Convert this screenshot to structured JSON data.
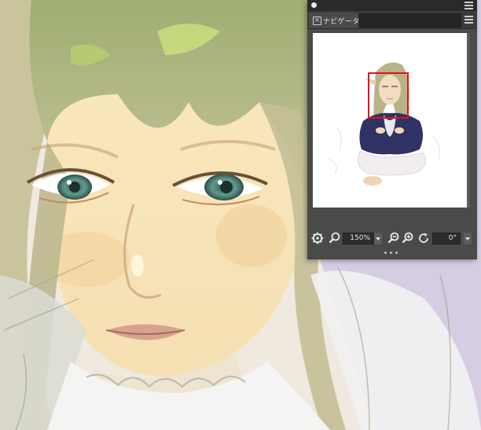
{
  "navigator": {
    "tab_label": "ナビゲータ",
    "zoom_value": "150%",
    "rotation_value": "0°",
    "viewport_rect_color": "#e0141e"
  },
  "icons": {
    "panel_menu": "hamburger-icon",
    "tab_close": "close-icon",
    "settings": "gear-icon",
    "zoom": "magnifier-icon",
    "zoom_out": "zoom-out-icon",
    "zoom_in": "zoom-in-icon",
    "rotate": "rotate-icon",
    "grip": "more-dots-icon"
  },
  "colors": {
    "panel_bg": "#4a4a4a",
    "titlebar_bg": "#2a2a2a",
    "field_bg": "#2c2c2c",
    "preview_bg": "#ffffff"
  }
}
